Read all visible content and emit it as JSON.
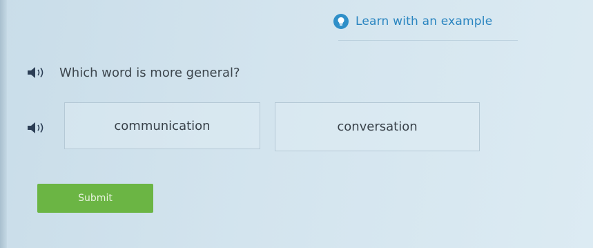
{
  "learn": {
    "label": "Learn with an example",
    "icon": "lightbulb-icon",
    "accent": "#2f8fc8"
  },
  "question": {
    "text": "Which word is more general?",
    "icon": "speaker-icon"
  },
  "choices": [
    {
      "label": "communication"
    },
    {
      "label": "conversation"
    }
  ],
  "submit": {
    "label": "Submit",
    "color": "#6bb544"
  }
}
